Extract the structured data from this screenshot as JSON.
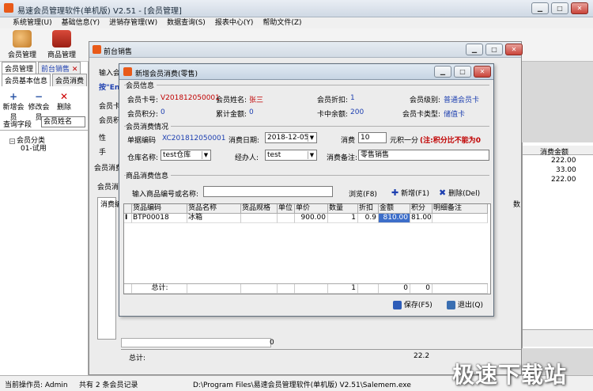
{
  "app": {
    "title": "易速会员管理软件(单机版) V2.51 - [会员管理]"
  },
  "menu": [
    "系统管理(U)",
    "基础信息(Y)",
    "进销存管理(W)",
    "数据查询(S)",
    "报表中心(Y)",
    "帮助文件(Z)"
  ],
  "toolbar": {
    "member_mgmt": "会员管理",
    "goods_mgmt": "商品管理"
  },
  "left_panel": {
    "tab_member_mgmt": "会员管理",
    "tab_front_sales": "前台销售",
    "tab_basic_info": "会员基本信息",
    "tab_consume": "会员消费",
    "btn_add": "新增会员",
    "btn_edit": "修改会员",
    "btn_delete": "删除",
    "query_label": "查询字段",
    "query_value": "会员姓名",
    "tree_root": "会员分类",
    "tree_child": "01-试用"
  },
  "bg_window": {
    "title": "前台销售",
    "label_input": "输入会",
    "label_hint": "按\"Ent",
    "label_card": "会员卡",
    "label_points": "会员积",
    "label_gender": "性",
    "label_hand": "手",
    "label_consume1": "会员消费",
    "label_consume2": "会员消",
    "col_consume_code": "消费编",
    "col_price": "价",
    "col_extra": "数",
    "total_label": "总计:",
    "total_value": "0",
    "bottom_value": "22.2"
  },
  "right_grid": {
    "header": "消费金额",
    "rows": [
      "222.00",
      "33.00",
      "222.00"
    ]
  },
  "dialog": {
    "title": "新增会员消费(零售)",
    "section_member": "会员信息",
    "card_no_label": "会员卡号:",
    "card_no": "V201812050001",
    "name_label": "会员姓名:",
    "name": "张三",
    "discount_label": "会员折扣:",
    "discount": "1",
    "level_label": "会员级别:",
    "level": "普通会员卡",
    "points_label": "会员积分:",
    "points": "0",
    "total_amount_label": "累计金额:",
    "total_amount": "0",
    "balance_label": "卡中余额:",
    "balance": "200",
    "card_type_label": "会员卡类型:",
    "card_type": "储值卡",
    "section_consume": "会员消费情况",
    "doc_no_label": "单据编码",
    "doc_no": "XC201812050001",
    "date_label": "消费日期:",
    "date": "2018-12-05",
    "consume_label": "消费",
    "consume_value": "10",
    "per_point_label": "元积一分",
    "note_red": "(注:积分比不能为0",
    "warehouse_label": "仓库名称:",
    "warehouse": "test仓库",
    "handler_label": "经办人:",
    "handler": "test",
    "remark_label": "消费备注:",
    "remark": "零售销售",
    "section_goods": "商品消费信息",
    "goods_input_label": "输入商品编号或名称:",
    "goods_input_value": "",
    "browse_label": "浏览(F8)",
    "add_label": "新增(F1)",
    "delete_label": "删除(Del)",
    "columns": [
      "货品编码",
      "货品名称",
      "货品规格",
      "单位",
      "单价",
      "数量",
      "折扣",
      "金额",
      "积分",
      "明细备注"
    ],
    "row": {
      "code": "BTP00018",
      "name": "冰箱",
      "spec": "",
      "unit": "",
      "price": "900.00",
      "qty": "1",
      "discount": "0.9",
      "amount": "810.00",
      "points": "81.00",
      "note": ""
    },
    "total_label": "总计:",
    "total_qty": "1",
    "total_points": "0",
    "save_label": "保存(F5)",
    "exit_label": "退出(Q)"
  },
  "status": {
    "operator": "当前操作员: Admin",
    "count": "共有 2 条会员记录",
    "path": "D:\\Program Files\\易速会员管理软件(单机版) V2.51\\Salemem.exe"
  },
  "watermark": "极速下载站",
  "colors": {
    "accent_blue": "#1d3fb0",
    "warning_red": "#c00000",
    "highlight": "#3d6ec9"
  }
}
